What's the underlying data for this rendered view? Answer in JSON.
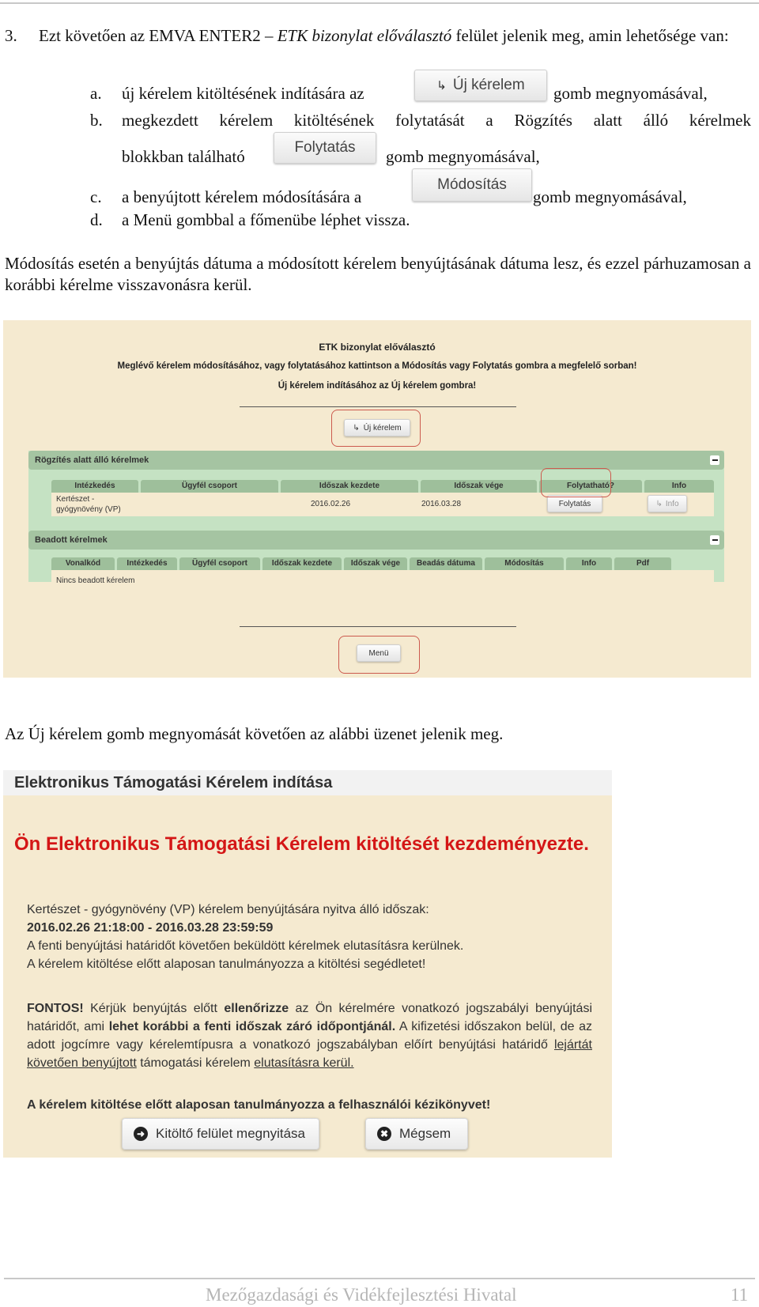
{
  "item3": {
    "number": "3.",
    "text_before": "Ezt követően az EMVA ENTER2 – ",
    "text_italic": "ETK bizonylat előválasztó",
    "text_after": " felület jelenik meg, amin lehetősége van:",
    "subitems": [
      {
        "letter": "a.",
        "before": "új kérelem kitöltésének indítására az",
        "button": "Új kérelem",
        "button_icon": "reply-arrow-icon",
        "after": "gomb megnyomásával,"
      },
      {
        "letter": "b.",
        "line1": "megkezdett kérelem kitöltésének folytatását a Rögzítés alatt álló kérelmek",
        "before": "blokkban található",
        "button": "Folytatás",
        "after": "gomb megnyomásával,"
      },
      {
        "letter": "c.",
        "before": "a benyújtott kérelem módosítására a",
        "button": "Módosítás",
        "after": "gomb megnyomásával,"
      },
      {
        "letter": "d.",
        "text": "a Menü gombbal a főmenübe léphet vissza."
      }
    ]
  },
  "paragraph2": "Módosítás esetén a benyújtás dátuma a módosított kérelem benyújtásának dátuma lesz, és ezzel párhuzamosan a korábbi kérelme visszavonásra kerül.",
  "screenshot1": {
    "title": "ETK bizonylat előválasztó",
    "instruction1": "Meglévő kérelem módosításához, vagy folytatásához kattintson a Módosítás vagy Folytatás gombra a megfelelő sorban!",
    "instruction2": "Új kérelem indításához az Új kérelem gombra!",
    "new_request_button": "Új kérelem",
    "panel_recording": {
      "title": "Rögzítés alatt álló kérelmek",
      "columns": [
        "Intézkedés",
        "Ügyfél csoport",
        "Időszak kezdete",
        "Időszak vége",
        "Folytatható?",
        "Info"
      ],
      "rows": [
        {
          "measure": "Kertészet - gyógynövény (VP)",
          "client_group": "",
          "period_start": "2016.02.26",
          "period_end": "2016.03.28",
          "continue_button": "Folytatás",
          "info_button": "Info"
        }
      ]
    },
    "panel_submitted": {
      "title": "Beadott kérelmek",
      "columns": [
        "Vonalkód",
        "Intézkedés",
        "Ügyfél csoport",
        "Időszak kezdete",
        "Időszak vége",
        "Beadás dátuma",
        "Módosítás",
        "Info",
        "Pdf"
      ],
      "empty_text": "Nincs beadott kérelem"
    },
    "menu_button": "Menü",
    "highlight_color": "#cc5a4e",
    "panel_color": "#c5e2c3",
    "background_color": "#f5ead0"
  },
  "paragraph3": "Az Új kérelem gomb megnyomását követően az alábbi üzenet jelenik meg.",
  "screenshot2": {
    "header": "Elektronikus Támogatási Kérelem indítása",
    "headline": "Ön Elektronikus Támogatási Kérelem kitöltését kezdeményezte.",
    "period_label": "Kertészet - gyógynövény (VP) kérelem benyújtására nyitva álló időszak:",
    "period_value": "2016.02.26 21:18:00 - 2016.03.28 23:59:59",
    "line3": "A fenti benyújtási határidőt követően beküldött kérelmek elutasításra kerülnek.",
    "line4": "A kérelem kitöltése előtt alaposan tanulmányozza a kitöltési segédletet!",
    "fontos": {
      "b1": "FONTOS!",
      "t1": " Kérjük benyújtás előtt ",
      "b2": "ellenőrizze",
      "t2": " az Ön kérelmére vonatkozó jogszabályi benyújtási határidőt, ami ",
      "b3": "lehet korábbi a fenti időszak záró időpontjánál.",
      "t3": " A kifizetési időszakon belül, de az adott jogcímre vagy kérelemtípusra a vonatkozó jogszabályban előírt benyújtási határidő ",
      "u1": "lejártát követően benyújtott",
      "t4": " támogatási kérelem ",
      "u2": "elutasításra kerül."
    },
    "final_note": "A kérelem kitöltése előtt alaposan tanulmányozza a felhasználói kézikönyvet!",
    "open_button": "Kitöltő felület megnyitása",
    "open_icon": "arrow-right-circle-icon",
    "cancel_button": "Mégsem",
    "cancel_icon": "close-circle-icon",
    "headline_color": "#d41616"
  },
  "footer": {
    "organization": "Mezőgazdasági és Vidékfejlesztési Hivatal",
    "page_number": "11"
  }
}
